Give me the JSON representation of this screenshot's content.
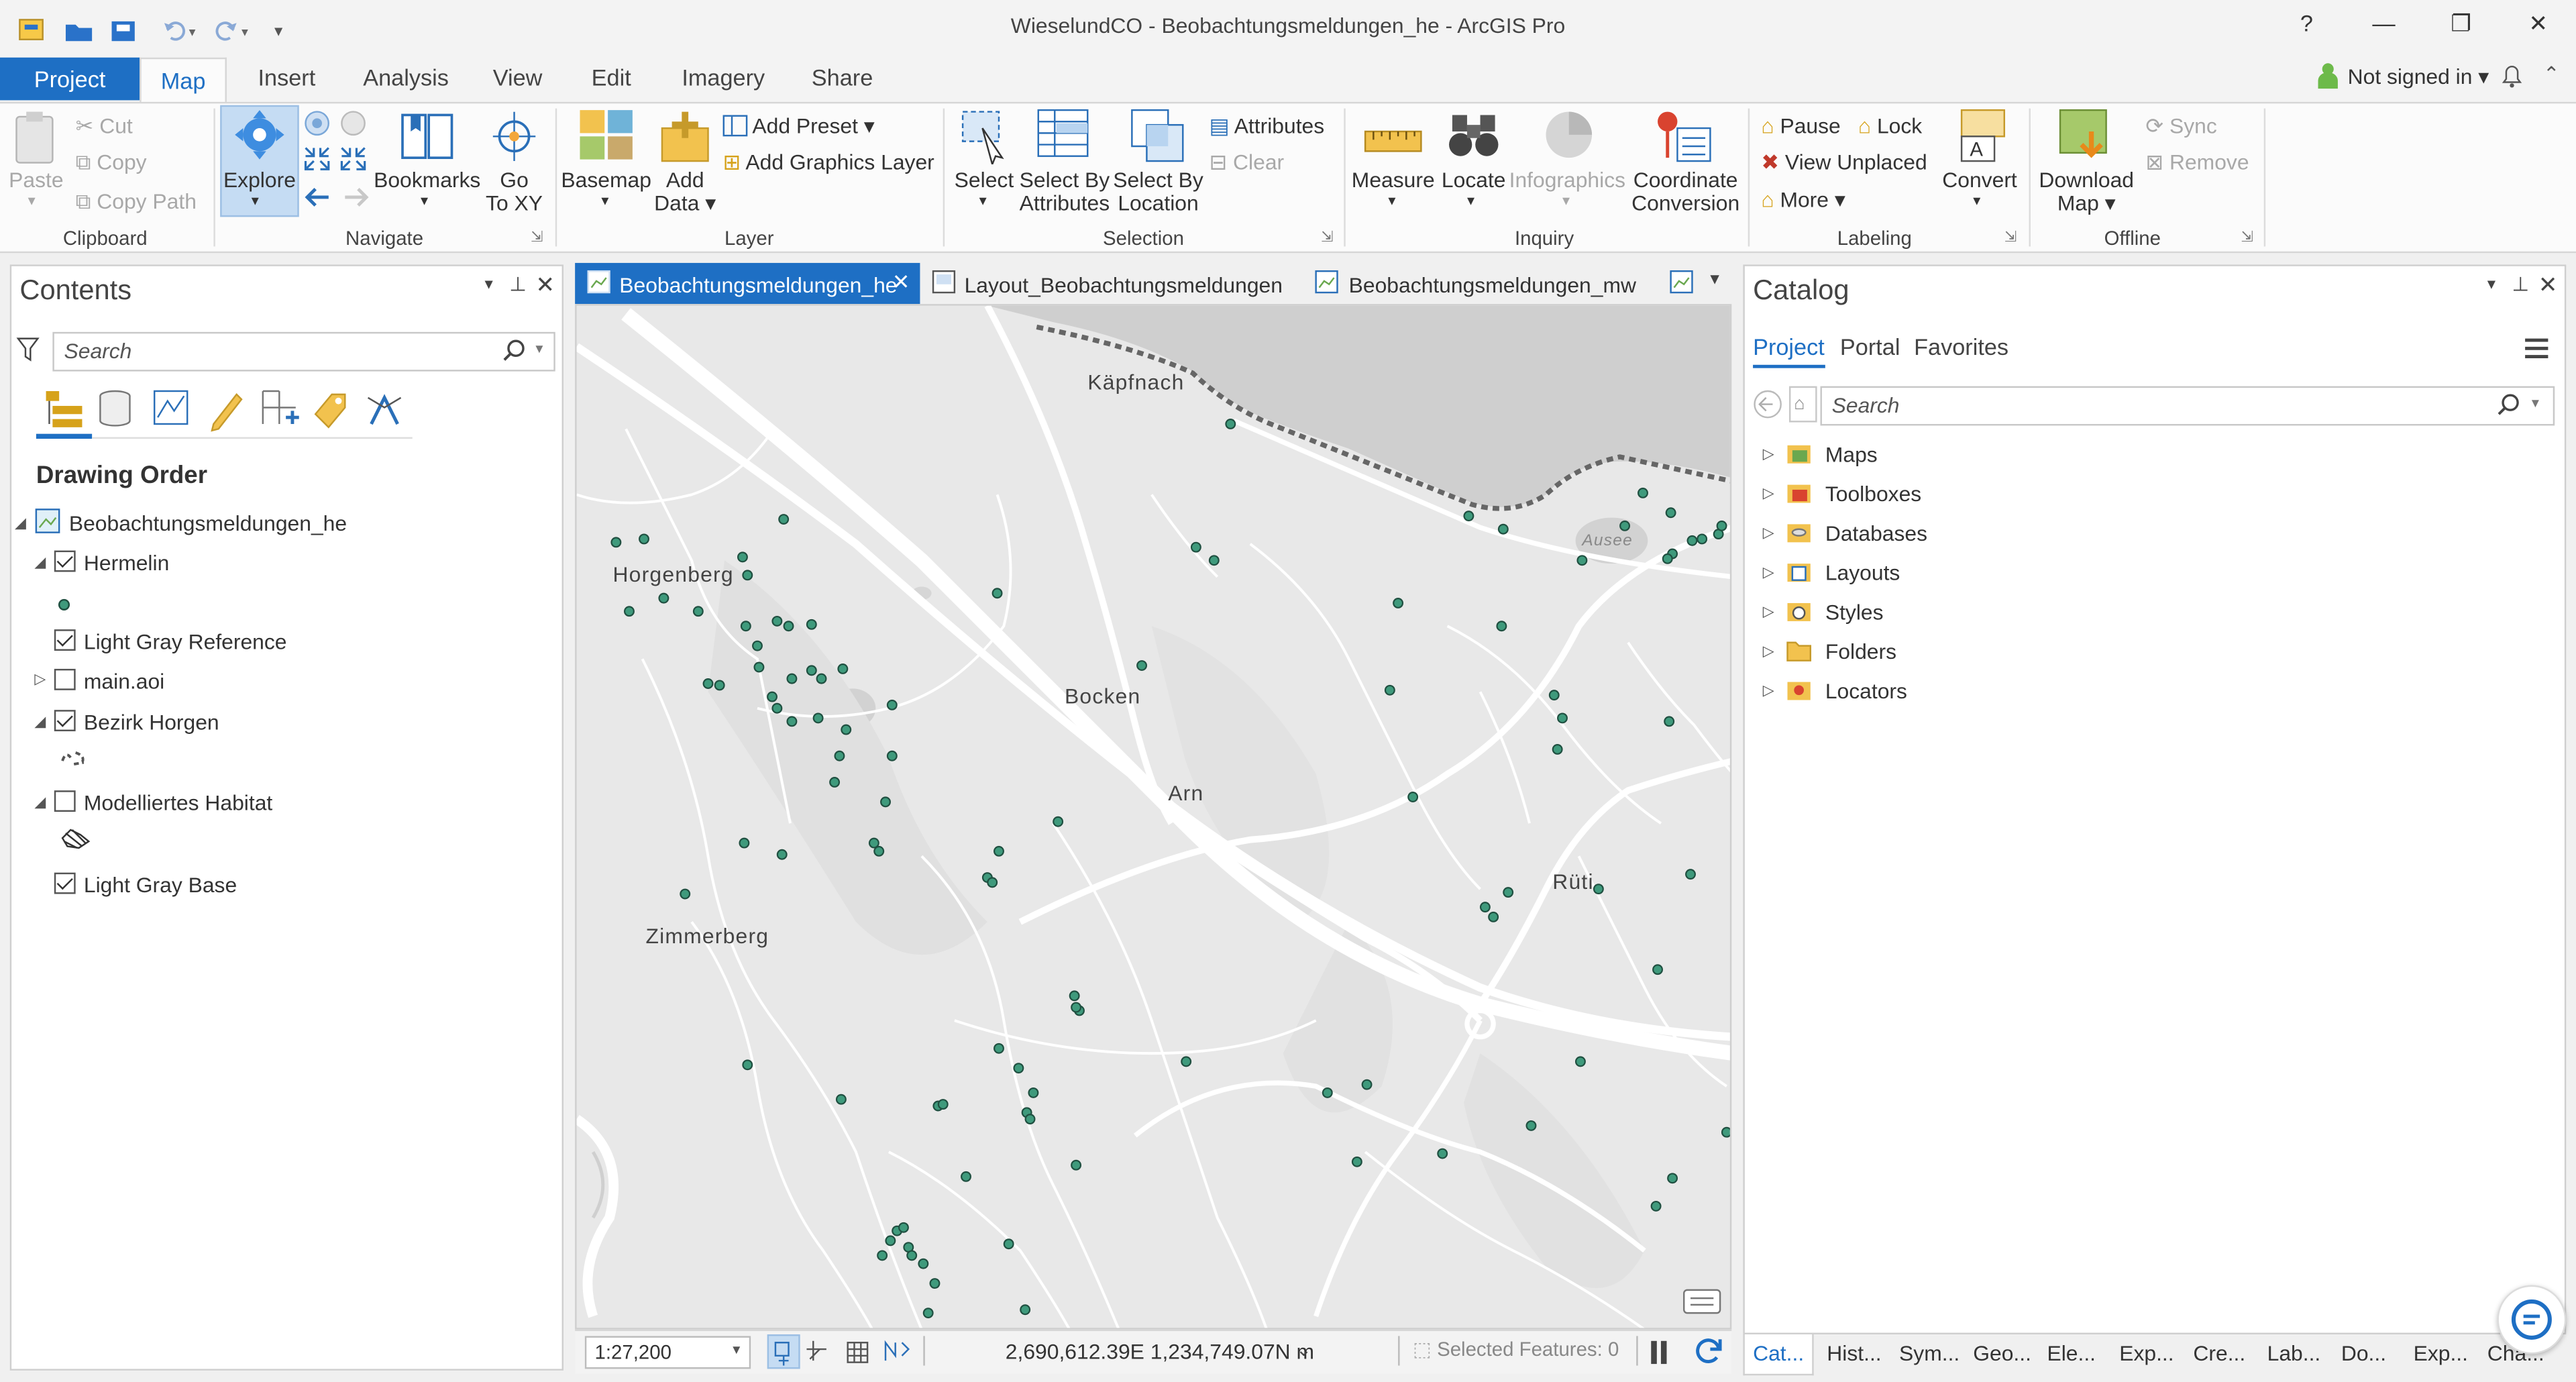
{
  "window": {
    "title": "WieselundCO - Beobachtungsmeldungen_he - ArcGIS Pro",
    "help": "?",
    "minimize": "—",
    "restore": "❐",
    "close": "✕"
  },
  "tabs": {
    "project": "Project",
    "map": "Map",
    "insert": "Insert",
    "analysis": "Analysis",
    "view": "View",
    "edit": "Edit",
    "imagery": "Imagery",
    "share": "Share",
    "signin": "Not signed in ▾"
  },
  "ribbon": {
    "clipboard": {
      "label": "Clipboard",
      "paste": "Paste",
      "cut": "Cut",
      "copy": "Copy",
      "copy_path": "Copy Path"
    },
    "navigate": {
      "label": "Navigate",
      "explore": "Explore",
      "bookmarks": "Bookmarks",
      "goto1": "Go",
      "goto2": "To XY"
    },
    "layer": {
      "label": "Layer",
      "basemap": "Basemap",
      "add_data1": "Add",
      "add_data2": "Data ▾",
      "add_preset": "Add Preset ▾",
      "add_graphics": "Add Graphics Layer"
    },
    "selection": {
      "label": "Selection",
      "select": "Select",
      "by_attr1": "Select By",
      "by_attr2": "Attributes",
      "by_loc1": "Select By",
      "by_loc2": "Location",
      "attributes": "Attributes",
      "clear": "Clear"
    },
    "inquiry": {
      "label": "Inquiry",
      "measure": "Measure",
      "locate": "Locate",
      "infographics": "Infographics",
      "coord1": "Coordinate",
      "coord2": "Conversion"
    },
    "labeling": {
      "label": "Labeling",
      "pause": "Pause",
      "lock": "Lock",
      "view_unplaced": "View Unplaced",
      "more": "More ▾",
      "convert": "Convert"
    },
    "offline": {
      "label": "Offline",
      "download1": "Download",
      "download2": "Map ▾",
      "sync": "Sync",
      "remove": "Remove"
    }
  },
  "contents": {
    "title": "Contents",
    "search_placeholder": "Search",
    "section": "Drawing Order",
    "map_name": "Beobachtungsmeldungen_he",
    "layers": [
      {
        "name": "Hermelin",
        "checked": true
      },
      {
        "name": "Light Gray Reference",
        "checked": true
      },
      {
        "name": "main.aoi",
        "checked": false
      },
      {
        "name": "Bezirk Horgen",
        "checked": true
      },
      {
        "name": "Modelliertes Habitat",
        "checked": false
      },
      {
        "name": "Light Gray Base",
        "checked": true
      }
    ]
  },
  "maptabs": {
    "active": "Beobachtungsmeldungen_he",
    "layout": "Layout_Beobachtungsmeldungen",
    "other": "Beobachtungsmeldungen_mw"
  },
  "map": {
    "places": [
      "Käpfnach",
      "Horgenberg",
      "Bocken",
      "Arn",
      "Rüti",
      "Zimmerberg",
      "Ausee"
    ],
    "point_color": "#3f9a7c",
    "scale": "1:27,200",
    "coordinates": "2,690,612.39E 1,234,749.07N m",
    "selected_features": "Selected Features: 0"
  },
  "catalog": {
    "title": "Catalog",
    "tabs": [
      "Project",
      "Portal",
      "Favorites"
    ],
    "search_placeholder": "Search",
    "items": [
      "Maps",
      "Toolboxes",
      "Databases",
      "Layouts",
      "Styles",
      "Folders",
      "Locators"
    ]
  },
  "bottom_tabs": [
    "Cat...",
    "Hist...",
    "Sym...",
    "Geo...",
    "Ele...",
    "Exp...",
    "Cre...",
    "Lab...",
    "Do...",
    "Exp...",
    "Cha..."
  ]
}
